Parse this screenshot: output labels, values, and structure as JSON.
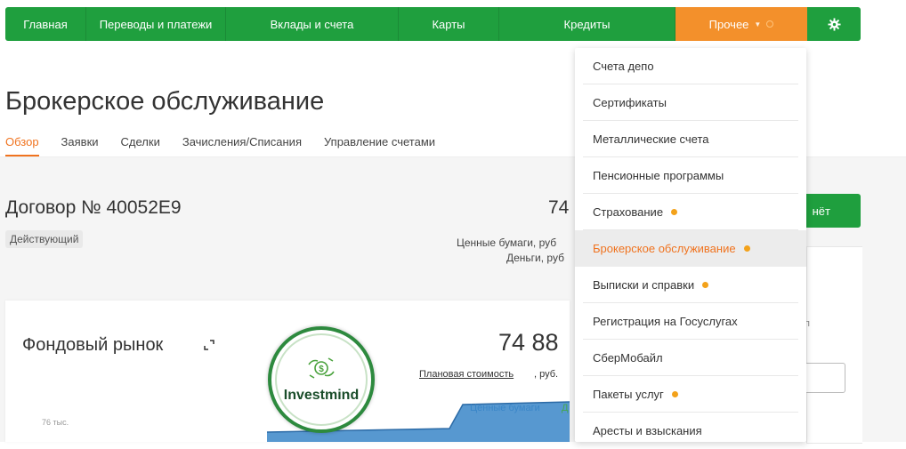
{
  "nav": {
    "items": [
      "Главная",
      "Переводы и платежи",
      "Вклады и счета",
      "Карты",
      "Кредиты"
    ],
    "other_label": "Прочее",
    "gear_symbol": "✱"
  },
  "page": {
    "title": "Брокерское обслуживание",
    "tabs": [
      "Обзор",
      "Заявки",
      "Сделки",
      "Зачисления/Списания",
      "Управление счетами"
    ]
  },
  "contract": {
    "title": "Договор № 40052E9",
    "status": "Действующий",
    "amount_visible": "74",
    "securities_label": "Ценные бумаги, руб",
    "money_label": "Деньги, руб"
  },
  "report_button": {
    "label_visible": "нёт"
  },
  "market": {
    "title": "Фондовый рынок",
    "amount_visible": "74 88",
    "planned_link": "Плановая стоимость",
    "planned_unit": ", руб.",
    "legend_securities": "Ценные бумаги",
    "legend_cash_visible": "Д",
    "y_tick": "76 тыс."
  },
  "watermark": {
    "text": "Investmind",
    "icon": "money-hands-icon"
  },
  "dropdown": {
    "items": [
      {
        "label": "Счета депо",
        "dot": false,
        "active": false
      },
      {
        "label": "Сертификаты",
        "dot": false,
        "active": false
      },
      {
        "label": "Металлические счета",
        "dot": false,
        "active": false
      },
      {
        "label": "Пенсионные программы",
        "dot": false,
        "active": false
      },
      {
        "label": "Страхование",
        "dot": true,
        "active": false
      },
      {
        "label": "Брокерское обслуживание",
        "dot": true,
        "active": true
      },
      {
        "label": "Выписки и справки",
        "dot": true,
        "active": false
      },
      {
        "label": "Регистрация на Госуслугах",
        "dot": false,
        "active": false
      },
      {
        "label": "СберМобайл",
        "dot": false,
        "active": false
      },
      {
        "label": "Пакеты услуг",
        "dot": true,
        "active": false
      },
      {
        "label": "Аресты и взыскания",
        "dot": false,
        "active": false
      }
    ]
  },
  "colors": {
    "brand_green": "#1f9f3e",
    "accent_orange": "#f3902b",
    "active_orange": "#f0731f",
    "dot_orange": "#f3a21b",
    "series_blue": "#3a86c8"
  }
}
